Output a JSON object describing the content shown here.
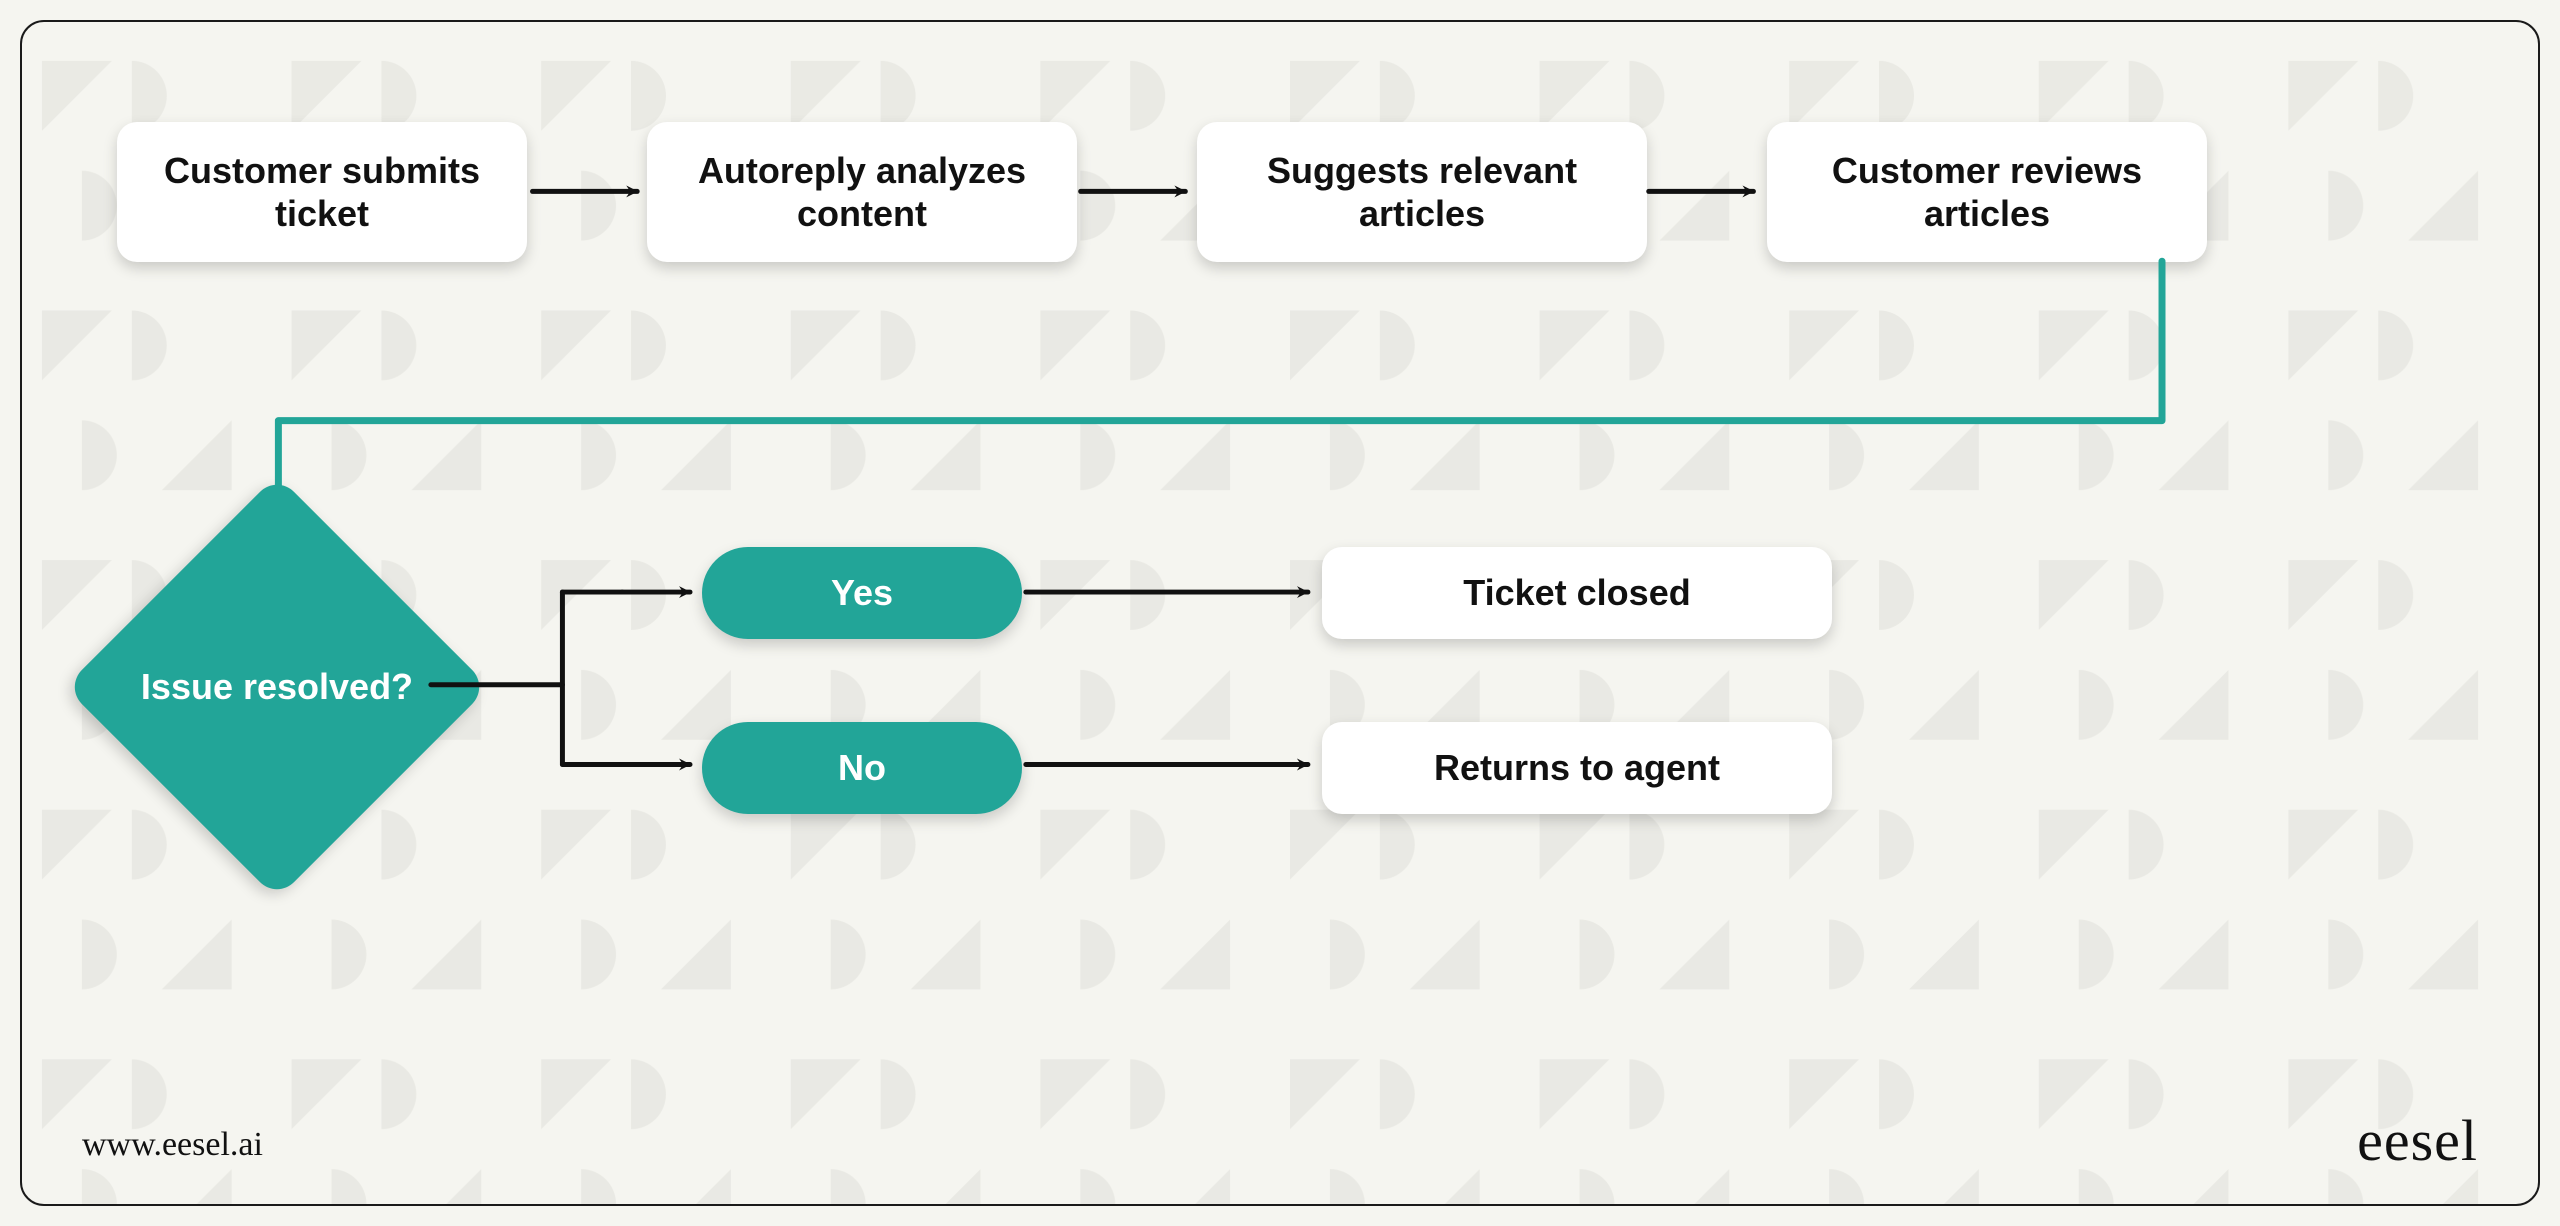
{
  "steps": {
    "s1": "Customer submits ticket",
    "s2": "Autoreply analyzes content",
    "s3": "Suggests relevant articles",
    "s4": "Customer reviews articles"
  },
  "decision": {
    "question": "Issue resolved?",
    "yes": "Yes",
    "no": "No"
  },
  "outcomes": {
    "closed": "Ticket closed",
    "agent": "Returns to agent"
  },
  "footer": {
    "url": "www.eesel.ai",
    "logo": "eesel"
  },
  "colors": {
    "accent": "#22a598",
    "ink": "#111111",
    "panel": "#ffffff",
    "bg": "#f5f5f0"
  }
}
